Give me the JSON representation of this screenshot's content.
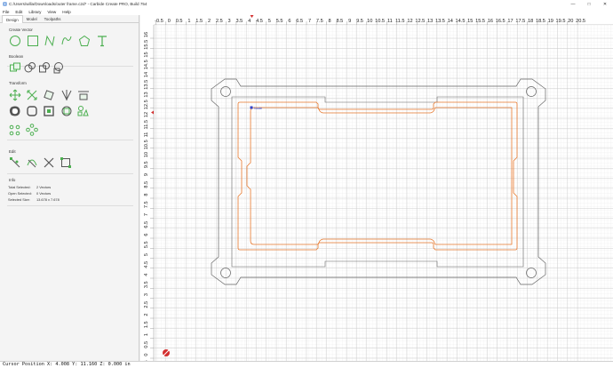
{
  "window": {
    "title": "C:/Users/willa/Downloads/outer frame.c2d* - Carbide Create PRO, Build 754",
    "controls": {
      "minimize": "—",
      "maximize": "□",
      "close": "✕"
    }
  },
  "menu": [
    "File",
    "Edit",
    "Library",
    "View",
    "Help"
  ],
  "sidebar": {
    "tabs": [
      "Design",
      "Model",
      "Toolpaths"
    ],
    "active_tab": "Design",
    "sections": {
      "create_vector": "Create Vector",
      "boolean": "Boolean",
      "transform": "Transform",
      "edit": "Edit",
      "info": "Info"
    },
    "info": [
      {
        "label": "Total Selected:",
        "value": "2 Vectors"
      },
      {
        "label": "Open Selected:",
        "value": "0 Vectors"
      },
      {
        "label": "Selected Size:",
        "value": "13.678 x 7.678"
      }
    ]
  },
  "rulers": {
    "x_labels": [
      "-0.5",
      "0",
      "0.5",
      "1",
      "1.5",
      "2",
      "2.5",
      "3",
      "3.5",
      "4",
      "4.5",
      "5",
      "5.5",
      "6",
      "6.5",
      "7",
      "7.5",
      "8",
      "8.5",
      "9",
      "9.5",
      "10",
      "10.5",
      "11",
      "11.5",
      "12",
      "12.5",
      "13",
      "13.5",
      "14",
      "14.5",
      "15",
      "15.5",
      "16",
      "16.5",
      "17",
      "17.5",
      "18",
      "18.5",
      "19",
      "19.5",
      "20",
      "20.5"
    ],
    "y_labels": [
      "16",
      "15.5",
      "15",
      "14.5",
      "14",
      "13.5",
      "13",
      "12.5",
      "12",
      "11.5",
      "11",
      "10.5",
      "10",
      "9.5",
      "9",
      "8.5",
      "8",
      "7.5",
      "7",
      "6.5",
      "6",
      "5.5",
      "5",
      "4.5",
      "4",
      "3.5",
      "3",
      "2.5",
      "2",
      "1.5",
      "1",
      "0.5",
      "0",
      "-0.5"
    ],
    "x_range": [
      -0.5,
      20.5
    ],
    "y_range": [
      16,
      -0.5
    ]
  },
  "canvas": {
    "node_label": "Node",
    "outline_color": "#666666",
    "selection_color": "#e8782c"
  },
  "status": {
    "text": "Cursor Position X: 4.008 Y: 11.160 Z: 0.000 in"
  }
}
